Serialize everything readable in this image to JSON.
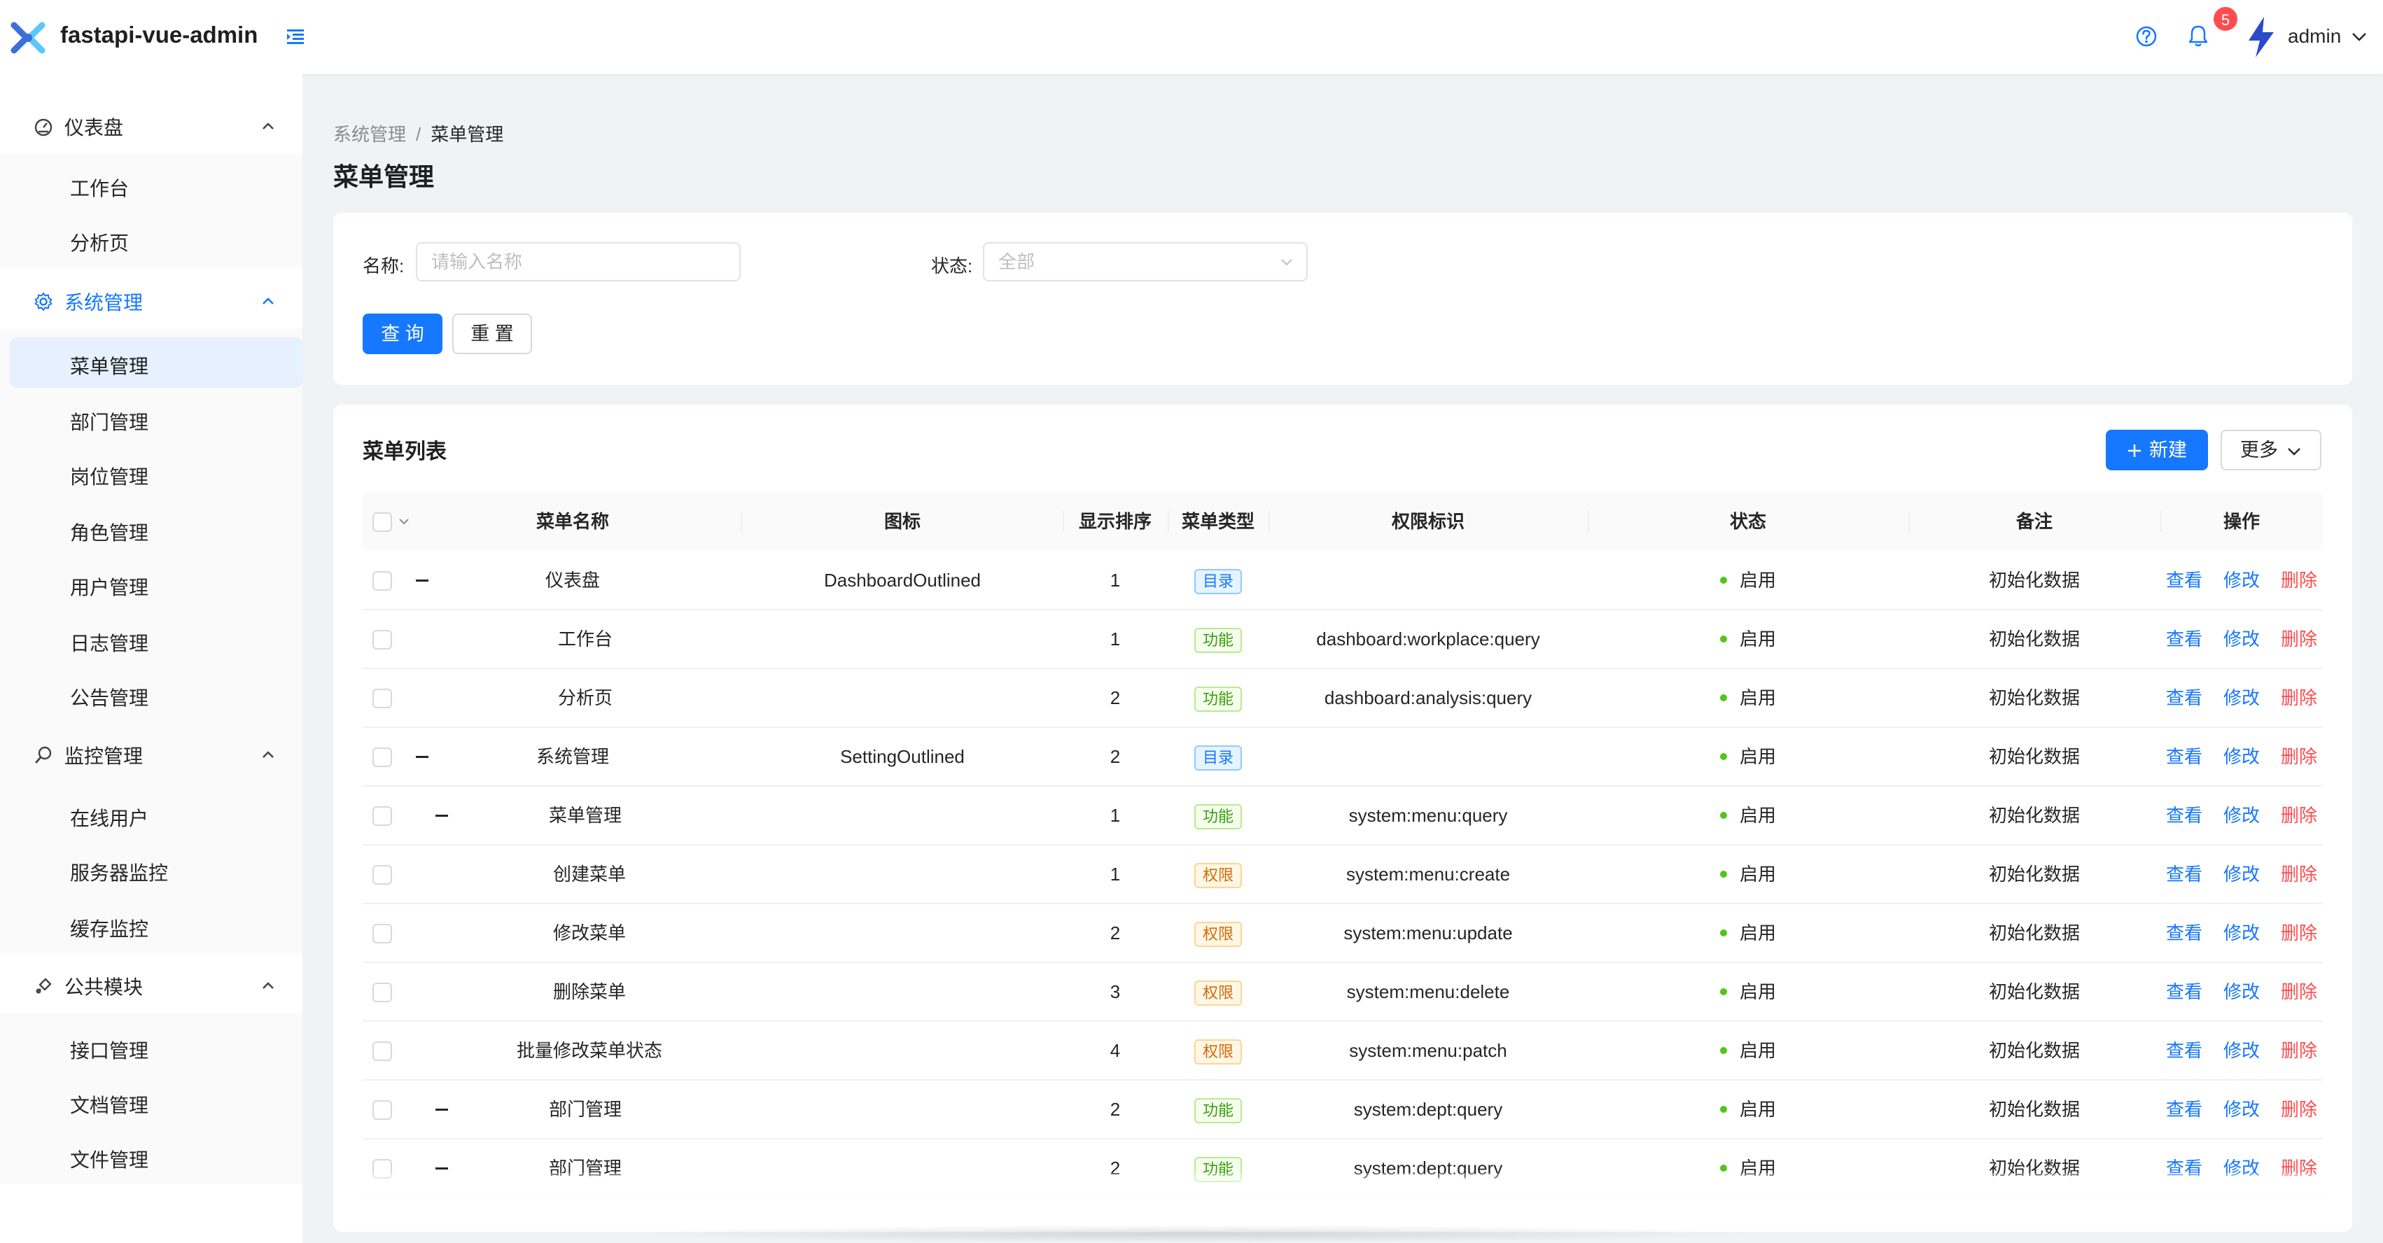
{
  "header": {
    "app_title": "fastapi-vue-admin",
    "notification_count": "5",
    "username": "admin"
  },
  "sidebar": {
    "groups": [
      {
        "label": "仪表盘",
        "icon": "dashboard-icon",
        "items": [
          "工作台",
          "分析页"
        ]
      },
      {
        "label": "系统管理",
        "icon": "setting-icon",
        "items": [
          "菜单管理",
          "部门管理",
          "岗位管理",
          "角色管理",
          "用户管理",
          "日志管理",
          "公告管理"
        ]
      },
      {
        "label": "监控管理",
        "icon": "monitor-icon",
        "items": [
          "在线用户",
          "服务器监控",
          "缓存监控"
        ]
      },
      {
        "label": "公共模块",
        "icon": "module-icon",
        "items": [
          "接口管理",
          "文档管理",
          "文件管理"
        ]
      }
    ],
    "selected": "菜单管理"
  },
  "breadcrumb": {
    "parent": "系统管理",
    "separator": "/",
    "current": "菜单管理"
  },
  "page_title": "菜单管理",
  "search": {
    "name_label": "名称:",
    "name_placeholder": "请输入名称",
    "status_label": "状态:",
    "status_value": "全部",
    "query_label": "查 询",
    "reset_label": "重 置"
  },
  "table": {
    "title": "菜单列表",
    "new_label": "新建",
    "more_label": "更多",
    "columns": [
      "菜单名称",
      "图标",
      "显示排序",
      "菜单类型",
      "权限标识",
      "状态",
      "备注",
      "操作"
    ],
    "actions": {
      "view": "查看",
      "edit": "修改",
      "delete": "删除"
    },
    "rows": [
      {
        "name": "仪表盘",
        "icon": "DashboardOutlined",
        "order": "1",
        "type": "目录",
        "type_kind": "dir",
        "perm": "",
        "status": "启用",
        "remark": "初始化数据",
        "level": 0,
        "expand": true
      },
      {
        "name": "工作台",
        "icon": "",
        "order": "1",
        "type": "功能",
        "type_kind": "fn",
        "perm": "dashboard:workplace:query",
        "status": "启用",
        "remark": "初始化数据",
        "level": 1,
        "expand": false
      },
      {
        "name": "分析页",
        "icon": "",
        "order": "2",
        "type": "功能",
        "type_kind": "fn",
        "perm": "dashboard:analysis:query",
        "status": "启用",
        "remark": "初始化数据",
        "level": 1,
        "expand": false
      },
      {
        "name": "系统管理",
        "icon": "SettingOutlined",
        "order": "2",
        "type": "目录",
        "type_kind": "dir",
        "perm": "",
        "status": "启用",
        "remark": "初始化数据",
        "level": 0,
        "expand": true
      },
      {
        "name": "菜单管理",
        "icon": "",
        "order": "1",
        "type": "功能",
        "type_kind": "fn",
        "perm": "system:menu:query",
        "status": "启用",
        "remark": "初始化数据",
        "level": 1,
        "expand": true
      },
      {
        "name": "创建菜单",
        "icon": "",
        "order": "1",
        "type": "权限",
        "type_kind": "perm",
        "perm": "system:menu:create",
        "status": "启用",
        "remark": "初始化数据",
        "level": 2,
        "expand": false
      },
      {
        "name": "修改菜单",
        "icon": "",
        "order": "2",
        "type": "权限",
        "type_kind": "perm",
        "perm": "system:menu:update",
        "status": "启用",
        "remark": "初始化数据",
        "level": 2,
        "expand": false
      },
      {
        "name": "删除菜单",
        "icon": "",
        "order": "3",
        "type": "权限",
        "type_kind": "perm",
        "perm": "system:menu:delete",
        "status": "启用",
        "remark": "初始化数据",
        "level": 2,
        "expand": false
      },
      {
        "name": "批量修改菜单状态",
        "icon": "",
        "order": "4",
        "type": "权限",
        "type_kind": "perm",
        "perm": "system:menu:patch",
        "status": "启用",
        "remark": "初始化数据",
        "level": 2,
        "expand": false
      },
      {
        "name": "部门管理",
        "icon": "",
        "order": "2",
        "type": "功能",
        "type_kind": "fn",
        "perm": "system:dept:query",
        "status": "启用",
        "remark": "初始化数据",
        "level": 1,
        "expand": true
      }
    ]
  },
  "colors": {
    "primary": "#1677ff",
    "danger": "#ff4d4f",
    "success": "#52c41a",
    "warning": "#d46b08"
  }
}
